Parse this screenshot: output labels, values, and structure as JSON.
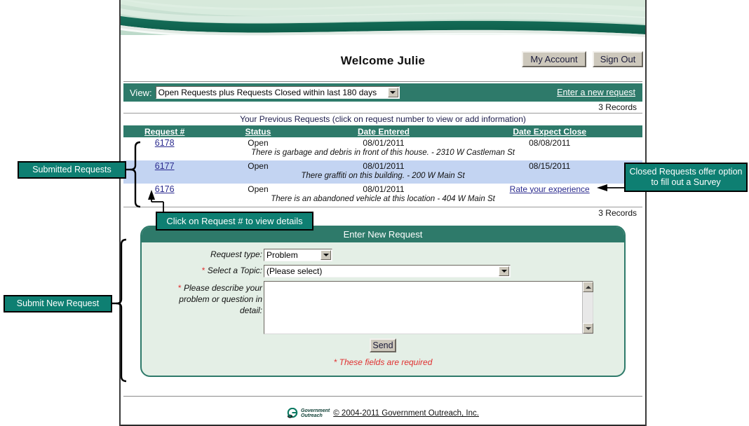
{
  "header": {
    "welcome_title": "Welcome Julie",
    "my_account_label": "My Account",
    "sign_out_label": "Sign Out"
  },
  "viewbar": {
    "view_label": "View:",
    "view_selected": "Open Requests plus Requests Closed within last 180 days",
    "new_request_link": "Enter a new request"
  },
  "requests": {
    "records_top": "3 Records",
    "records_bottom": "3 Records",
    "caption": "Your Previous Requests (click on request number to view or add information)",
    "columns": [
      "Request #",
      "Status",
      "Date Entered",
      "Date Expect Close"
    ],
    "rows": [
      {
        "request_no": "6178",
        "status": "Open",
        "date_entered": "08/01/2011",
        "date_expect_close": "08/08/2011",
        "close_is_link": false,
        "description": "There is garbage and debris in front of this house. - 2310 W Castleman St",
        "highlighted": false
      },
      {
        "request_no": "6177",
        "status": "Open",
        "date_entered": "08/01/2011",
        "date_expect_close": "08/15/2011",
        "close_is_link": false,
        "description": "There graffiti on this building. - 200 W Main St",
        "highlighted": true
      },
      {
        "request_no": "6176",
        "status": "Open",
        "date_entered": "08/01/2011",
        "date_expect_close": "Rate your experience",
        "close_is_link": true,
        "description": "There is an abandoned vehicle at this location - 404 W Main St",
        "highlighted": false
      }
    ]
  },
  "form": {
    "panel_title": "Enter New Request",
    "request_type_label": "Request type:",
    "request_type_value": "Problem",
    "topic_label_required": "*",
    "topic_label": "Select a Topic:",
    "topic_value": "(Please select)",
    "describe_label_required": "*",
    "describe_label_line1": "Please describe your",
    "describe_label_line2": "problem or question in",
    "describe_label_line3": "detail:",
    "describe_value": "",
    "send_label": "Send",
    "required_note": "* These fields are required"
  },
  "footer": {
    "logo_line1": "Government",
    "logo_line2": "Outreach",
    "copyright": "© 2004-2011 Government Outreach, Inc."
  },
  "annotations": {
    "submitted_requests": "Submitted  Requests",
    "submit_new_request": "Submit New Request",
    "click_request": "Click on Request # to view details",
    "closed_survey": "Closed Requests offer option to fill out a Survey"
  },
  "colors": {
    "brand_green": "#2e7a6a",
    "callout_green": "#0e7f72",
    "panel_bg": "#e4efe6",
    "row_highlight": "#c3d4f2",
    "link_blue": "#2b2b8f",
    "required_red": "#e03030",
    "button_face": "#cdc8bc"
  }
}
